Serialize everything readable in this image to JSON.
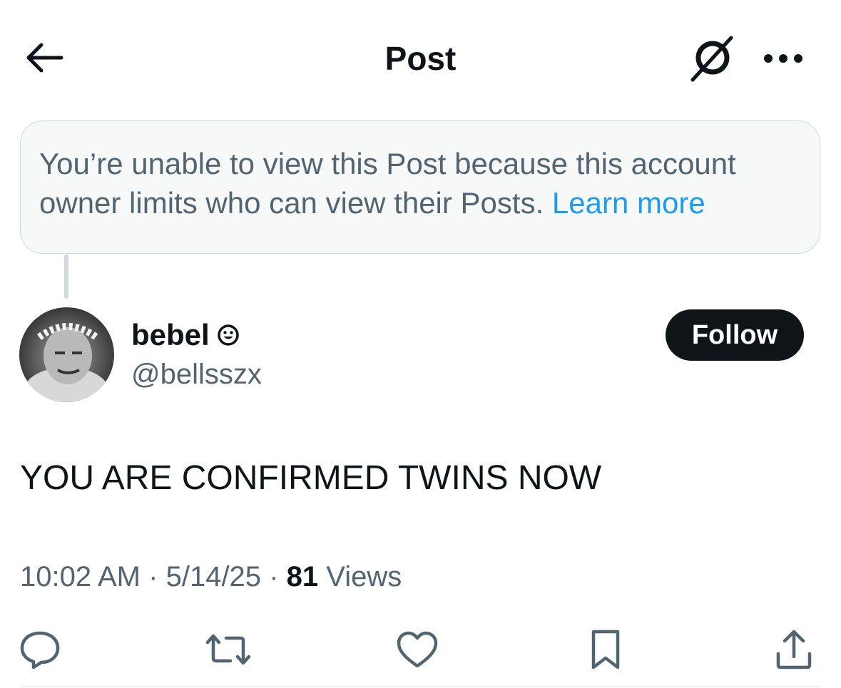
{
  "header": {
    "title": "Post",
    "back_icon": "arrow-left-icon",
    "grok_icon": "grok-icon",
    "more_icon": "ellipsis-icon"
  },
  "notice": {
    "text": "You’re unable to view this Post because this account owner limits who can view their Posts. ",
    "link": "Learn more"
  },
  "author": {
    "display_name": "bebel",
    "name_badge_icon": "smiley-icon",
    "handle": "@bellsszx",
    "follow_label": "Follow"
  },
  "post": {
    "text": "YOU ARE CONFIRMED TWINS NOW",
    "time": "10:02 AM",
    "separator": "·",
    "date": "5/14/25",
    "views_count": "81",
    "views_label": "Views"
  },
  "actions": [
    "reply-icon",
    "repost-icon",
    "like-icon",
    "bookmark-icon",
    "share-icon"
  ],
  "colors": {
    "text_primary": "#0f1419",
    "text_secondary": "#536471",
    "link": "#1d9bf0",
    "notice_bg": "#f7f9f9",
    "border": "#cfd9de"
  }
}
